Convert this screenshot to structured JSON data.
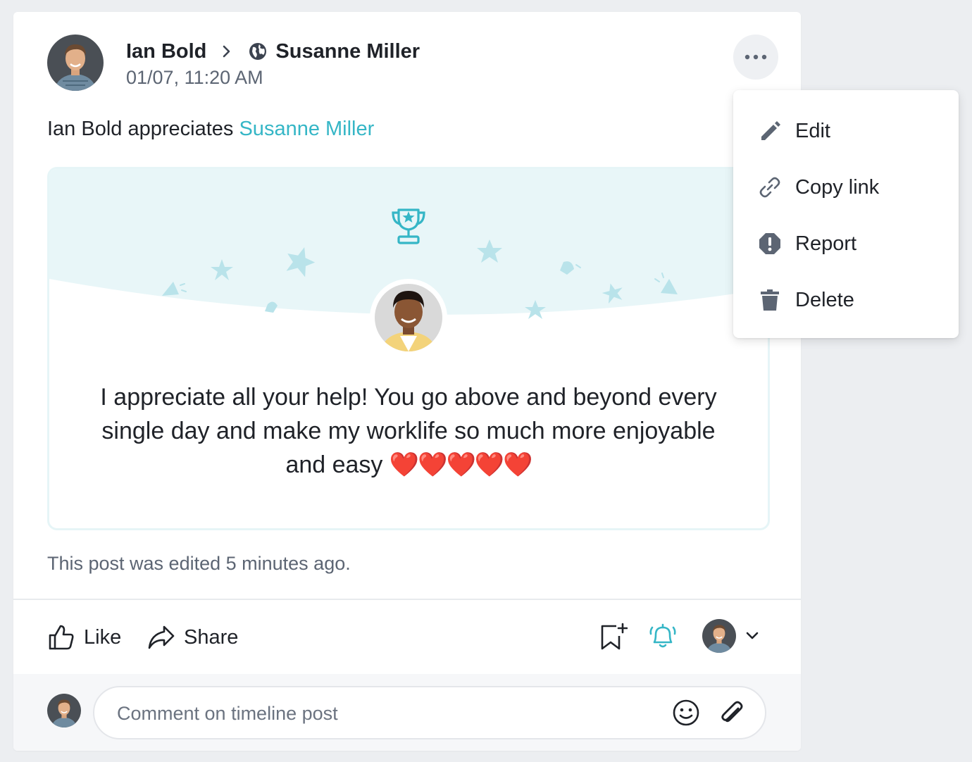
{
  "post": {
    "author": "Ian Bold",
    "target": "Susanne Miller",
    "timestamp": "01/07, 11:20 AM",
    "appreciates_prefix": "Ian Bold appreciates ",
    "appreciates_name": "Susanne Miller",
    "message": "I appreciate all your help! You go above and beyond every single day and make my worklife so much more enjoyable and easy ",
    "hearts": "❤️❤️❤️❤️❤️",
    "edited_note": "This post was edited 5 minutes ago."
  },
  "actions": {
    "like": "Like",
    "share": "Share"
  },
  "comment": {
    "placeholder": "Comment on timeline post"
  },
  "menu": {
    "items": [
      {
        "label": "Edit",
        "icon": "pencil-icon"
      },
      {
        "label": "Copy link",
        "icon": "link-icon"
      },
      {
        "label": "Report",
        "icon": "report-icon"
      },
      {
        "label": "Delete",
        "icon": "trash-icon"
      }
    ]
  },
  "colors": {
    "accent": "#35b6c6",
    "appreciation_bg": "#e8f6f8",
    "text": "#1f2228",
    "muted": "#5c6573"
  }
}
